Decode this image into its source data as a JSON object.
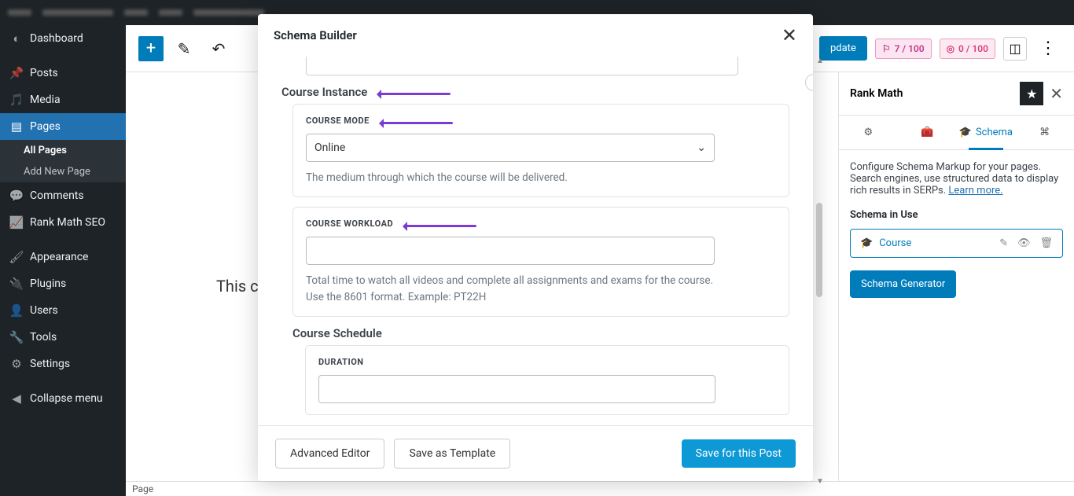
{
  "adminbar": {},
  "sidebar": {
    "items": [
      {
        "label": "Dashboard",
        "icon": "speed"
      },
      {
        "label": "Posts",
        "icon": "pin"
      },
      {
        "label": "Media",
        "icon": "media"
      },
      {
        "label": "Pages",
        "icon": "pages",
        "current": true
      },
      {
        "label": "Comments",
        "icon": "comment"
      },
      {
        "label": "Rank Math SEO",
        "icon": "chart"
      },
      {
        "label": "Appearance",
        "icon": "brush"
      },
      {
        "label": "Plugins",
        "icon": "plug"
      },
      {
        "label": "Users",
        "icon": "user"
      },
      {
        "label": "Tools",
        "icon": "wrench"
      },
      {
        "label": "Settings",
        "icon": "gear"
      },
      {
        "label": "Collapse menu",
        "icon": "collapse"
      }
    ],
    "submenu": {
      "items": [
        {
          "label": "All Pages",
          "bold": true
        },
        {
          "label": "Add New Page"
        }
      ]
    }
  },
  "editor": {
    "topbar": {
      "update_label": "pdate",
      "score1": "7 / 100",
      "score2": "0 / 100"
    },
    "content_text": "This c",
    "footer_label": "Page"
  },
  "schema_panel": {
    "title": "Rank Math",
    "tabs": [
      "",
      "",
      "Schema",
      ""
    ],
    "desc1": "Configure Schema Markup for your pages. Search engines, use structured data to display rich results in SERPs. ",
    "learn_more": "Learn more.",
    "in_use_title": "Schema in Use",
    "in_use_item": "Course",
    "generator_label": "Schema Generator"
  },
  "modal": {
    "title": "Schema Builder",
    "section_instance": "Course Instance",
    "prop_mode": {
      "label": "COURSE MODE",
      "value": "Online",
      "help": "The medium through which the course will be delivered."
    },
    "prop_workload": {
      "label": "COURSE WORKLOAD",
      "value": "",
      "help": "Total time to watch all videos and complete all assignments and exams for the course. Use the 8601 format. Example: PT22H"
    },
    "section_schedule": "Course Schedule",
    "prop_duration": {
      "label": "DURATION",
      "value": ""
    },
    "footer": {
      "advanced": "Advanced Editor",
      "save_template": "Save as Template",
      "save_post": "Save for this Post"
    }
  }
}
